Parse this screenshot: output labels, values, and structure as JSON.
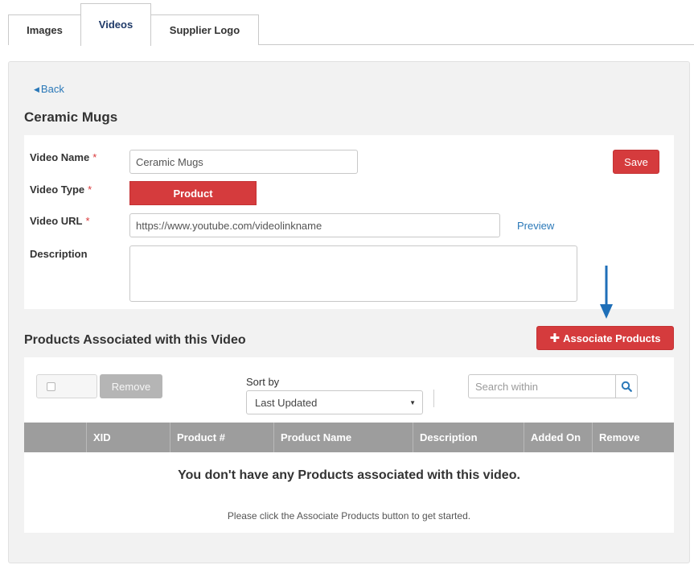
{
  "tabs": [
    {
      "label": "Images",
      "active": false
    },
    {
      "label": "Videos",
      "active": true
    },
    {
      "label": "Supplier Logo",
      "active": false
    }
  ],
  "back_link": "Back",
  "page_title": "Ceramic Mugs",
  "form": {
    "required_mark": "*",
    "video_name": {
      "label": "Video Name",
      "value": "Ceramic Mugs"
    },
    "video_type": {
      "label": "Video Type",
      "selected": "Product"
    },
    "video_url": {
      "label": "Video URL",
      "value": "https://www.youtube.com/videolinkname"
    },
    "description": {
      "label": "Description",
      "value": ""
    },
    "save_label": "Save",
    "preview_label": "Preview"
  },
  "products_section": {
    "title": "Products Associated with this Video",
    "associate_label": "Associate Products",
    "remove_label": "Remove",
    "sort_label": "Sort by",
    "sort_selected": "Last Updated",
    "search_placeholder": "Search within",
    "columns": [
      "",
      "XID",
      "Product #",
      "Product Name",
      "Description",
      "Added On",
      "Remove"
    ],
    "empty_title": "You don't have any Products associated with this video.",
    "empty_subtitle": "Please click the Associate Products button to get started."
  },
  "colors": {
    "accent_red": "#d53b3d",
    "link_blue": "#2a78b8",
    "arrow_blue": "#1f6fb8",
    "table_header": "#9d9d9d"
  },
  "icons": {
    "back": "caret-left-icon",
    "plus": "plus-icon",
    "dropdown": "chevron-down-icon",
    "search": "search-icon",
    "annotation": "arrow-down-icon"
  }
}
